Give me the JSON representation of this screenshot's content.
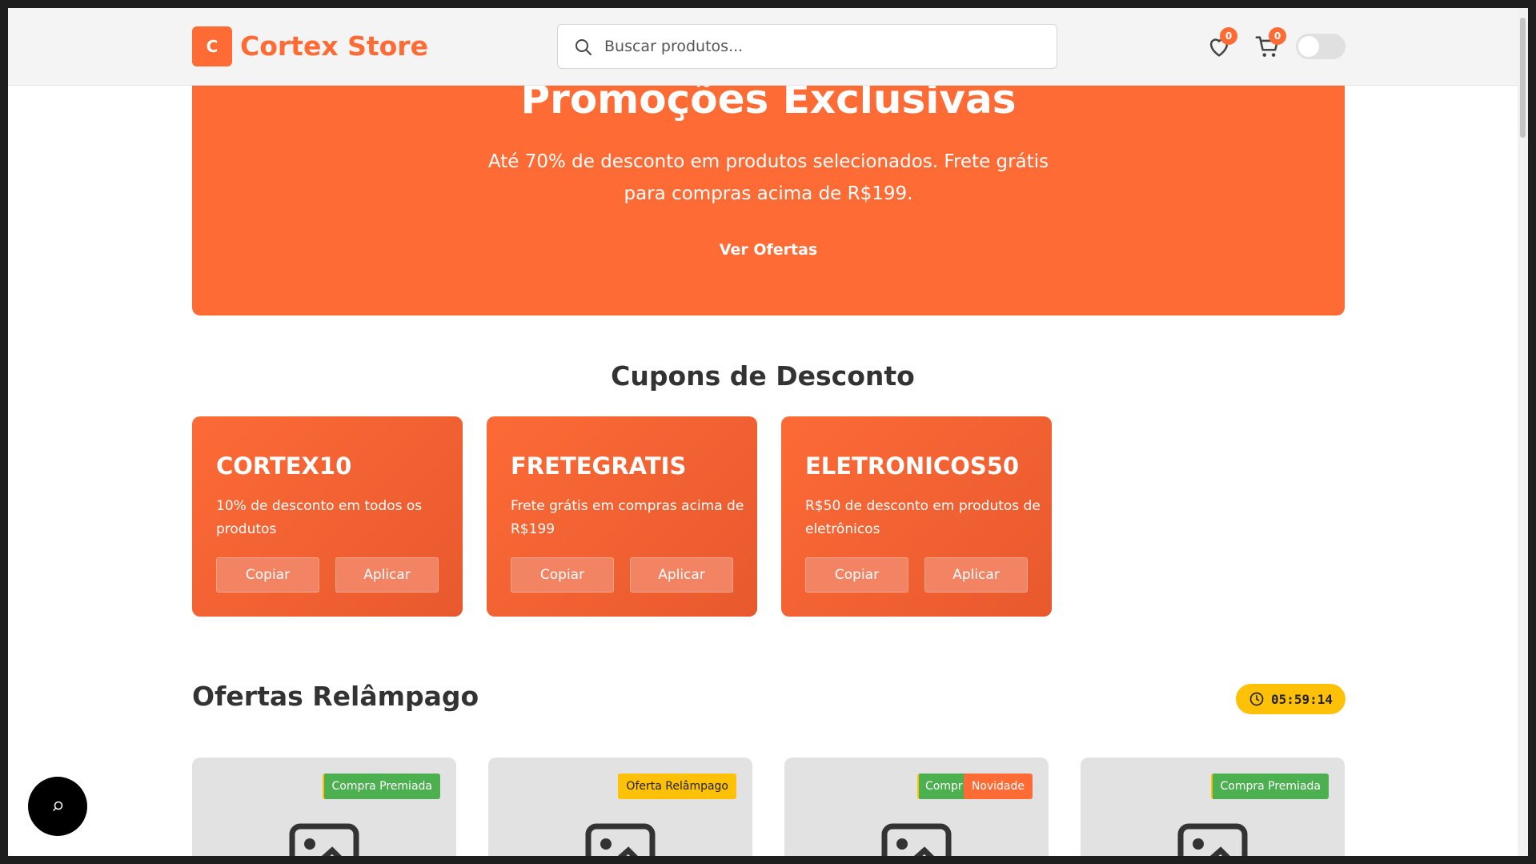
{
  "header": {
    "logo_letter": "C",
    "store_name": "Cortex Store",
    "search_placeholder": "Buscar produtos...",
    "wishlist_count": "0",
    "cart_count": "0",
    "dark_mode": false
  },
  "hero": {
    "title": "Promoções Exclusivas",
    "subtitle": "Até 70% de desconto em produtos selecionados. Frete grátis para compras acima de R$199.",
    "cta_label": "Ver Ofertas"
  },
  "coupons": {
    "section_title": "Cupons de Desconto",
    "items": [
      {
        "code": "CORTEX10",
        "description": "10% de desconto em todos os produtos",
        "copy_label": "Copiar",
        "apply_label": "Aplicar"
      },
      {
        "code": "FRETEGRATIS",
        "description": "Frete grátis em compras acima de R$199",
        "copy_label": "Copiar",
        "apply_label": "Aplicar"
      },
      {
        "code": "ELETRONICOS50",
        "description": "R$50 de desconto em produtos de eletrônicos",
        "copy_label": "Copiar",
        "apply_label": "Aplicar"
      }
    ]
  },
  "flash_sales": {
    "title": "Ofertas Relâmpago",
    "timer": "05:59:14",
    "products": [
      {
        "tags": [
          "Compra Premiada"
        ]
      },
      {
        "tags": [
          "Oferta Relâmpago"
        ]
      },
      {
        "tags": [
          "Compr",
          "Novidade"
        ]
      },
      {
        "tags": [
          "Compra Premiada"
        ]
      }
    ]
  },
  "colors": {
    "accent": "#ff6b35",
    "green_tag": "#4caf50",
    "yellow_tag": "#ffc107"
  },
  "icons": [
    "search-icon",
    "heart-icon",
    "cart-icon",
    "clock-icon",
    "image-placeholder-icon",
    "chat-icon"
  ]
}
